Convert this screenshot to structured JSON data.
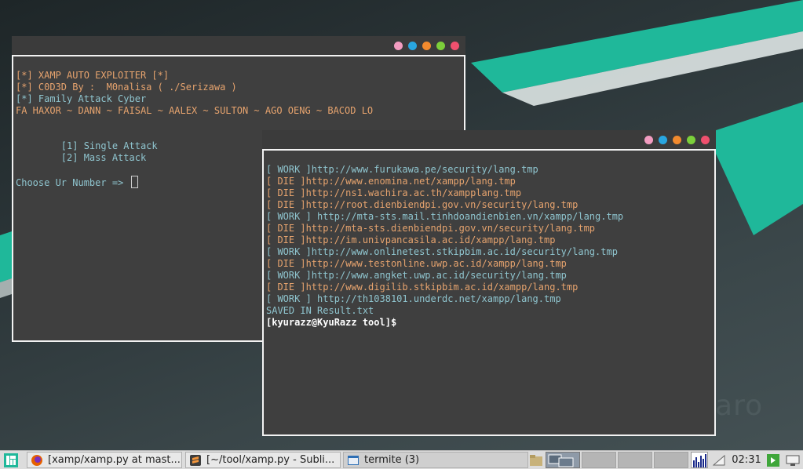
{
  "window1": {
    "lines": [
      {
        "text": "[*] XAMP AUTO EXPLOITER [*]",
        "cls": "orange"
      },
      {
        "text": "[*] C0D3D By :  M0nalisa ( ./Serizawa )",
        "cls": "orange"
      },
      {
        "text": "[*] Family Attack Cyber",
        "cls": "cyan"
      },
      {
        "text": "FA HAXOR ~ DANN ~ FAISAL ~ AALEX ~ SULTON ~ AGO OENG ~ BACOD LO",
        "cls": "orange"
      },
      {
        "text": "",
        "cls": ""
      },
      {
        "text": "",
        "cls": ""
      },
      {
        "text": "        [1] Single Attack",
        "cls": "cyan"
      },
      {
        "text": "        [2] Mass Attack",
        "cls": "cyan"
      },
      {
        "text": "",
        "cls": ""
      }
    ],
    "prompt": "Choose Ur Number => "
  },
  "window2": {
    "lines": [
      {
        "text": "[ WORK ]http://www.furukawa.pe/security/lang.tmp",
        "cls": "cyan"
      },
      {
        "text": "[ DIE ]http://www.enomina.net/xampp/lang.tmp",
        "cls": "orange"
      },
      {
        "text": "[ DIE ]http://ns1.wachira.ac.th/xampplang.tmp",
        "cls": "orange"
      },
      {
        "text": "[ DIE ]http://root.dienbiendpi.gov.vn/security/lang.tmp",
        "cls": "orange"
      },
      {
        "text": "[ WORK ] http://mta-sts.mail.tinhdoandienbien.vn/xampp/lang.tmp",
        "cls": "cyan"
      },
      {
        "text": "[ DIE ]http://mta-sts.dienbiendpi.gov.vn/security/lang.tmp",
        "cls": "orange"
      },
      {
        "text": "[ DIE ]http://im.univpancasila.ac.id/xampp/lang.tmp",
        "cls": "orange"
      },
      {
        "text": "[ WORK ]http://www.onlinetest.stkipbim.ac.id/security/lang.tmp",
        "cls": "cyan"
      },
      {
        "text": "[ DIE ]http://www.testonline.uwp.ac.id/xampp/lang.tmp",
        "cls": "orange"
      },
      {
        "text": "[ WORK ]http://www.angket.uwp.ac.id/security/lang.tmp",
        "cls": "cyan"
      },
      {
        "text": "[ DIE ]http://www.digilib.stkipbim.ac.id/xampp/lang.tmp",
        "cls": "orange"
      },
      {
        "text": "[ WORK ] http://th1038101.underdc.net/xampp/lang.tmp",
        "cls": "cyan"
      },
      {
        "text": "SAVED IN Result.txt",
        "cls": "cyan"
      }
    ],
    "prompt_user": "[kyurazz@KyuRazz ",
    "prompt_dir": "tool",
    "prompt_end": "]$"
  },
  "title_dots": [
    "#f29cc0",
    "#29a6e0",
    "#f28a2e",
    "#7ccf3a",
    "#f0506e"
  ],
  "desktop": {
    "watermark": "jaro"
  },
  "taskbar": {
    "tasks": [
      {
        "label": "[xamp/xamp.py at mast...",
        "icon": "firefox-icon"
      },
      {
        "label": "[~/tool/xamp.py - Subli...",
        "icon": "sublime-icon"
      },
      {
        "label": "termite (3)",
        "icon": "terminal-icon"
      }
    ],
    "clock": "02:31"
  }
}
